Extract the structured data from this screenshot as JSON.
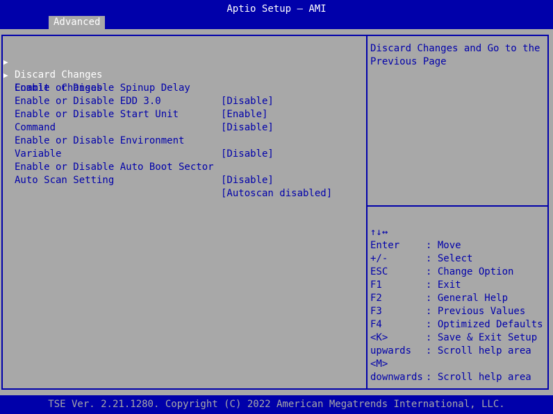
{
  "header": {
    "title": "Aptio Setup – AMI",
    "tab": "Advanced"
  },
  "menu": {
    "items": [
      {
        "label": "Discard Changes",
        "value": "",
        "submenu": true,
        "selected": true
      },
      {
        "label": "Commit  Changes",
        "value": "",
        "submenu": true,
        "selected": false
      },
      {
        "label": "Enable or Disable Spinup Delay",
        "value": "[Disable]"
      },
      {
        "label": "Enable or Disable EDD 3.0",
        "value": "[Enable]"
      },
      {
        "label": "Enable or Disable Start Unit",
        "label2": "Command",
        "value": "[Disable]"
      },
      {
        "label": "Enable or Disable Environment",
        "label2": "Variable",
        "value": "[Disable]"
      },
      {
        "label": "Enable or Disable Auto Boot Sector",
        "value": "[Disable]"
      },
      {
        "label": "Auto Scan Setting",
        "value": "[Autoscan disabled]"
      }
    ]
  },
  "help": {
    "text": "Discard Changes and Go to the Previous Page"
  },
  "keys": [
    {
      "key": "↑↓↔",
      "desc": ": Move"
    },
    {
      "key": "Enter",
      "desc": ": Select"
    },
    {
      "key": "+/-",
      "desc": ": Change Option"
    },
    {
      "key": "ESC",
      "desc": ": Exit"
    },
    {
      "key": "F1",
      "desc": ": General Help"
    },
    {
      "key": "F2",
      "desc": ": Previous Values"
    },
    {
      "key": "F3",
      "desc": ": Optimized Defaults"
    },
    {
      "key": "F4",
      "desc": ": Save & Exit Setup"
    },
    {
      "key": "<K>",
      "desc": ": Scroll help area",
      "cont": "upwards"
    },
    {
      "key": "<M>",
      "desc": ": Scroll help area",
      "cont": "downwards"
    }
  ],
  "footer": {
    "text": "TSE Ver. 2.21.1280. Copyright (C) 2022 American Megatrends International, LLC."
  },
  "colors": {
    "background": "#0000AA",
    "panel": "#A8A8A8",
    "text": "#0000AA",
    "highlight": "#FFFFFF"
  }
}
